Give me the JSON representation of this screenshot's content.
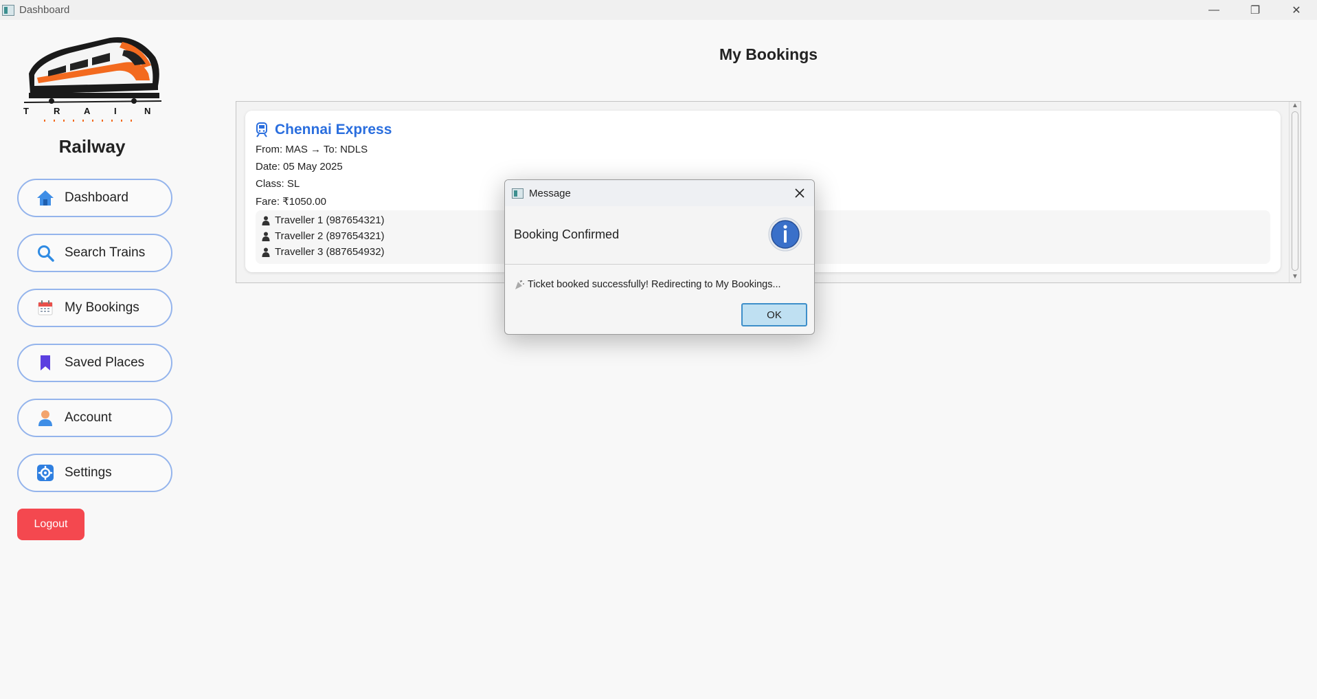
{
  "window": {
    "title": "Dashboard",
    "controls": {
      "minimize": "—",
      "maximize": "❐",
      "close": "✕"
    }
  },
  "sidebar": {
    "logo_text": "TRAIN",
    "brand": "Railway",
    "items": [
      {
        "label": "Dashboard",
        "icon": "home-icon"
      },
      {
        "label": "Search Trains",
        "icon": "search-icon"
      },
      {
        "label": "My Bookings",
        "icon": "calendar-icon"
      },
      {
        "label": "Saved Places",
        "icon": "bookmark-icon"
      },
      {
        "label": "Account",
        "icon": "user-icon"
      },
      {
        "label": "Settings",
        "icon": "gear-icon"
      }
    ],
    "logout_label": "Logout"
  },
  "main": {
    "title": "My Bookings",
    "bookings": [
      {
        "train_name": "Chennai Express",
        "route": "From: MAS → To: NDLS",
        "date": "Date: 05 May 2025",
        "class": "Class: SL",
        "fare": "Fare: ₹1050.00",
        "travellers": [
          "Traveller 1 (987654321)",
          "Traveller 2 (897654321)",
          "Traveller 3 (887654932)"
        ]
      }
    ]
  },
  "dialog": {
    "title": "Message",
    "heading": "Booking Confirmed",
    "message": "Ticket booked successfully! Redirecting to My Bookings...",
    "ok_label": "OK",
    "icon": "info-icon"
  },
  "colors": {
    "accent": "#2a6ede",
    "nav_border": "#94b4ec",
    "logout": "#f4484f",
    "ok_button_bg": "#bfe0f2",
    "ok_button_border": "#3d8ec9"
  }
}
